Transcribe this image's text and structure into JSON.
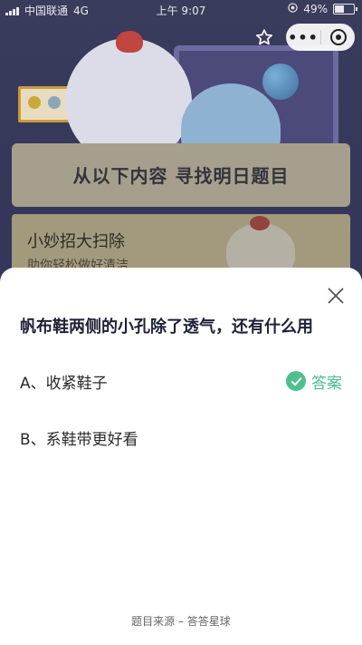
{
  "status_bar": {
    "carrier": "中国联通",
    "network": "4G",
    "time": "上午 9:07",
    "battery": "49%"
  },
  "background": {
    "board_title": "从以下内容 寻找明日题目",
    "card_title": "小妙招大扫除",
    "card_subtitle": "助你轻松做好清洁"
  },
  "menu": {
    "more_label": "•••"
  },
  "sheet": {
    "question": "帆布鞋两侧的小孔除了透气，还有什么用",
    "options": [
      {
        "label": "A、收紧鞋子",
        "is_answer": true
      },
      {
        "label": "B、系鞋带更好看",
        "is_answer": false
      }
    ],
    "answer_label": "答案",
    "footer": "题目来源 – 答答星球"
  },
  "colors": {
    "accent_green": "#4fc08d",
    "question_text": "#1f2136"
  },
  "icons": [
    "signal-icon",
    "location-icon",
    "battery-icon",
    "star-icon",
    "more-icon",
    "close-circle-icon",
    "close-icon",
    "check-icon"
  ]
}
